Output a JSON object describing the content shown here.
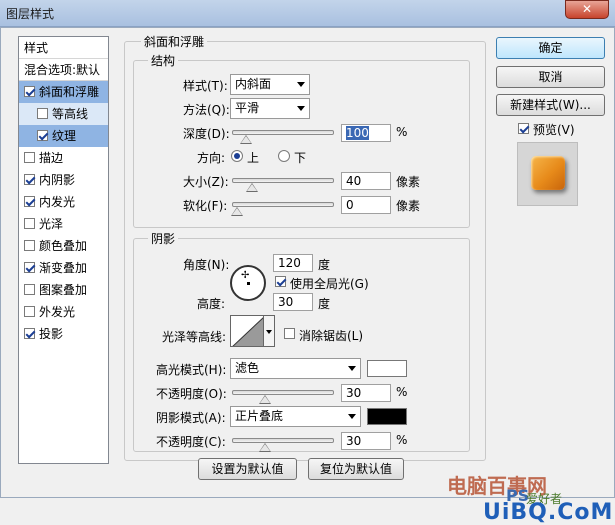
{
  "window": {
    "title": "图层样式",
    "close_glyph": "✕"
  },
  "style_list": {
    "header": "样式",
    "blend_options": "混合选项:默认",
    "items": [
      {
        "label": "斜面和浮雕",
        "checked": true
      },
      {
        "label": "等高线",
        "checked": false
      },
      {
        "label": "纹理",
        "checked": true
      },
      {
        "label": "描边",
        "checked": false
      },
      {
        "label": "内阴影",
        "checked": true
      },
      {
        "label": "内发光",
        "checked": true
      },
      {
        "label": "光泽",
        "checked": false
      },
      {
        "label": "颜色叠加",
        "checked": false
      },
      {
        "label": "渐变叠加",
        "checked": true
      },
      {
        "label": "图案叠加",
        "checked": false
      },
      {
        "label": "外发光",
        "checked": false
      },
      {
        "label": "投影",
        "checked": true
      }
    ]
  },
  "bevel": {
    "title": "斜面和浮雕",
    "structure": {
      "title": "结构",
      "style_label": "样式(T):",
      "style_value": "内斜面",
      "method_label": "方法(Q):",
      "method_value": "平滑",
      "depth_label": "深度(D):",
      "depth_value": "100",
      "depth_unit": "%",
      "depth_level": 0.1,
      "direction_label": "方向:",
      "dir_up": "上",
      "dir_down": "下",
      "size_label": "大小(Z):",
      "size_value": "40",
      "size_unit": "像素",
      "size_level": 0.16,
      "soften_label": "软化(F):",
      "soften_value": "0",
      "soften_unit": "像素",
      "soften_level": 0.0
    },
    "shading": {
      "title": "阴影",
      "angle_label": "角度(N):",
      "angle_value": "120",
      "angle_unit": "度",
      "global_light": "使用全局光(G)",
      "altitude_label": "高度:",
      "altitude_value": "30",
      "altitude_unit": "度",
      "gloss_label": "光泽等高线:",
      "antialias": "消除锯齿(L)",
      "highlight_mode_label": "高光模式(H):",
      "highlight_mode": "滤色",
      "highlight_color": "#ffffff",
      "highlight_opacity_label": "不透明度(O):",
      "highlight_opacity": "30",
      "highlight_opacity_unit": "%",
      "highlight_level": 0.3,
      "shadow_mode_label": "阴影模式(A):",
      "shadow_mode": "正片叠底",
      "shadow_color": "#000000",
      "shadow_opacity_label": "不透明度(C):",
      "shadow_opacity": "30",
      "shadow_opacity_unit": "%",
      "shadow_level": 0.3
    },
    "make_default": "设置为默认值",
    "reset_default": "复位为默认值"
  },
  "buttons": {
    "ok": "确定",
    "cancel": "取消",
    "new_style": "新建样式(W)...",
    "preview": "预览(V)"
  },
  "watermark": {
    "line1": "电脑百事网",
    "ps": "PS",
    "ps_tail": "爱好者",
    "uibq": "UiBQ.CoM"
  }
}
